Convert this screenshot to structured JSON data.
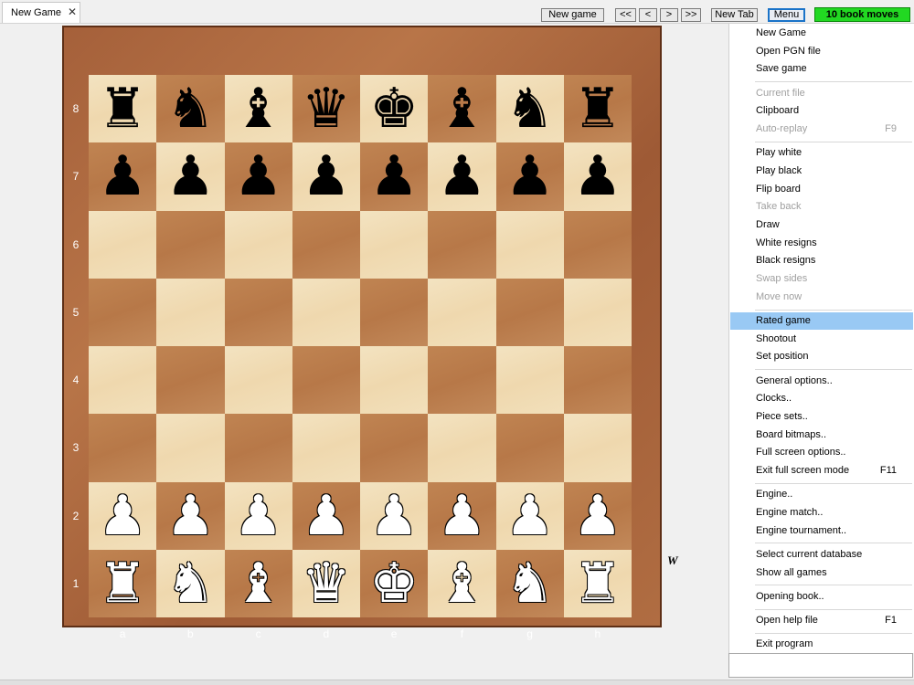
{
  "tab": {
    "label": "New Game",
    "close": "✕"
  },
  "toolbar": {
    "new_game": "New game",
    "first": "<<",
    "prev": "<",
    "next": ">",
    "last": ">>",
    "new_tab": "New Tab",
    "menu": "Menu",
    "book_moves": "10 book moves"
  },
  "colors": {
    "book_moves_bg": "#22d822",
    "menu_highlight": "#99c9f4",
    "frame": "#a5603a",
    "light_square": "#f0dcb5",
    "dark_square": "#bb7c4b"
  },
  "board": {
    "ranks": [
      "8",
      "7",
      "6",
      "5",
      "4",
      "3",
      "2",
      "1"
    ],
    "files": [
      "a",
      "b",
      "c",
      "d",
      "e",
      "f",
      "g",
      "h"
    ],
    "side_to_move": "W",
    "position": [
      [
        "bR",
        "bN",
        "bB",
        "bQ",
        "bK",
        "bB",
        "bN",
        "bR"
      ],
      [
        "bP",
        "bP",
        "bP",
        "bP",
        "bP",
        "bP",
        "bP",
        "bP"
      ],
      [
        "",
        "",
        "",
        "",
        "",
        "",
        "",
        ""
      ],
      [
        "",
        "",
        "",
        "",
        "",
        "",
        "",
        ""
      ],
      [
        "",
        "",
        "",
        "",
        "",
        "",
        "",
        ""
      ],
      [
        "",
        "",
        "",
        "",
        "",
        "",
        "",
        ""
      ],
      [
        "wP",
        "wP",
        "wP",
        "wP",
        "wP",
        "wP",
        "wP",
        "wP"
      ],
      [
        "wR",
        "wN",
        "wB",
        "wQ",
        "wK",
        "wB",
        "wN",
        "wR"
      ]
    ]
  },
  "menu": {
    "items": [
      {
        "label": "New Game"
      },
      {
        "label": "Open PGN file"
      },
      {
        "label": "Save game"
      },
      {
        "sep": true
      },
      {
        "label": "Current file",
        "disabled": true
      },
      {
        "label": "Clipboard"
      },
      {
        "label": "Auto-replay",
        "disabled": true,
        "shortcut": "F9"
      },
      {
        "sep": true
      },
      {
        "label": "Play white"
      },
      {
        "label": "Play black"
      },
      {
        "label": "Flip board"
      },
      {
        "label": "Take back",
        "disabled": true
      },
      {
        "label": "Draw"
      },
      {
        "label": "White resigns"
      },
      {
        "label": "Black resigns"
      },
      {
        "label": "Swap sides",
        "disabled": true
      },
      {
        "label": "Move now",
        "disabled": true
      },
      {
        "sep": true
      },
      {
        "label": "Rated game",
        "active": true
      },
      {
        "label": "Shootout"
      },
      {
        "label": "Set position"
      },
      {
        "sep": true
      },
      {
        "label": "General options.."
      },
      {
        "label": "Clocks.."
      },
      {
        "label": "Piece sets.."
      },
      {
        "label": "Board bitmaps.."
      },
      {
        "label": "Full screen options.."
      },
      {
        "label": "Exit full screen mode",
        "shortcut": "F11"
      },
      {
        "sep": true
      },
      {
        "label": "Engine.."
      },
      {
        "label": "Engine match.."
      },
      {
        "label": "Engine tournament.."
      },
      {
        "sep": true
      },
      {
        "label": "Select current database"
      },
      {
        "label": "Show all games"
      },
      {
        "sep": true
      },
      {
        "label": "Opening book.."
      },
      {
        "sep": true
      },
      {
        "label": "Open help file",
        "shortcut": "F1"
      },
      {
        "sep": true
      },
      {
        "label": "Exit program"
      }
    ]
  }
}
